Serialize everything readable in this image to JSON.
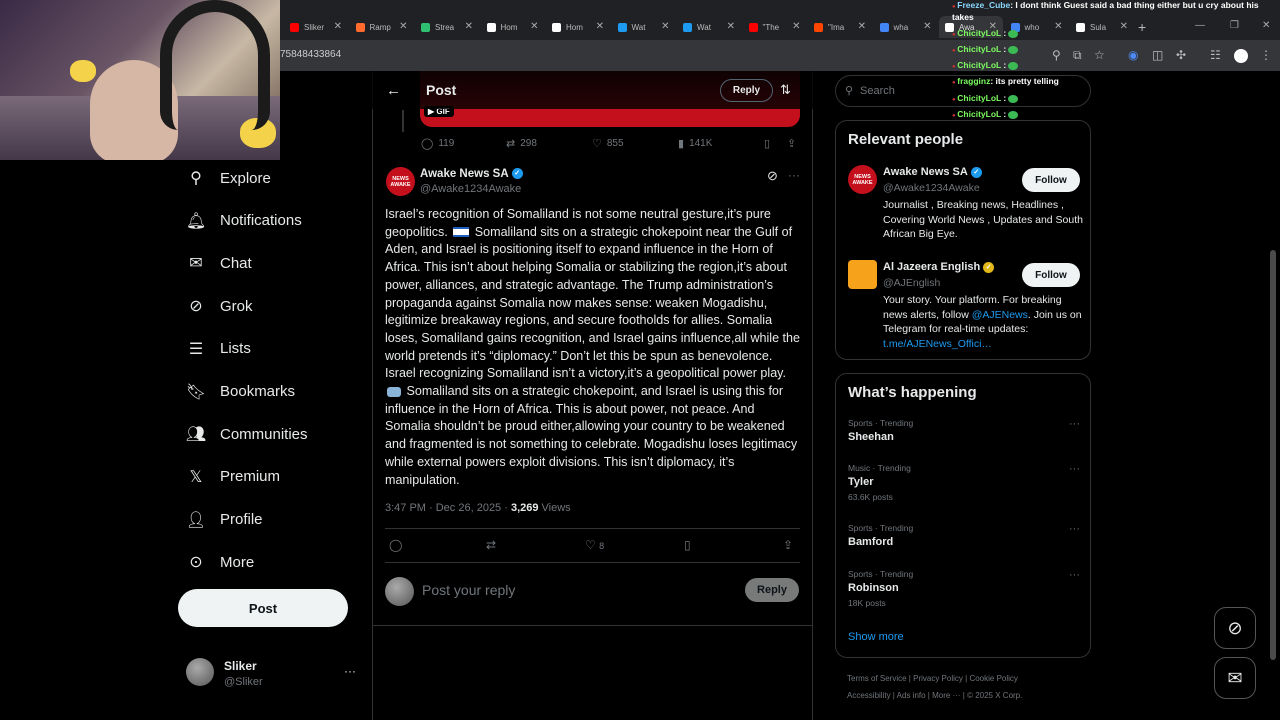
{
  "browser": {
    "tabs": [
      {
        "label": "Sliker",
        "color": "#ff0000"
      },
      {
        "label": "Ramp",
        "color": "#ff6b2c"
      },
      {
        "label": "Strea",
        "color": "#2fbf71"
      },
      {
        "label": "Hom",
        "color": "#ffffff"
      },
      {
        "label": "Hom",
        "color": "#ffffff"
      },
      {
        "label": "Wat",
        "color": "#1d9bf0"
      },
      {
        "label": "Wat",
        "color": "#1d9bf0"
      },
      {
        "label": "\"The",
        "color": "#ff0000"
      },
      {
        "label": "\"Ima",
        "color": "#ff4500"
      },
      {
        "label": "wha",
        "color": "#4285f4"
      },
      {
        "label": "Awa",
        "color": "#ffffff"
      },
      {
        "label": "who",
        "color": "#4285f4"
      },
      {
        "label": "Sula",
        "color": "#ffffff"
      }
    ],
    "url": "75848433864"
  },
  "chat": [
    {
      "user": "Freeze_Cube",
      "color": "blue",
      "msg": ": I dont think Guest said a bad thing either but u cry about his"
    },
    {
      "user": "",
      "color": "blue",
      "msg": "takes"
    },
    {
      "user": "ChicityLoL",
      "color": "green",
      "msg": " :"
    },
    {
      "user": "ChicityLoL",
      "color": "green",
      "msg": " :"
    },
    {
      "user": "ChicityLoL",
      "color": "green",
      "msg": " :"
    },
    {
      "user": "fragginz",
      "color": "green",
      "msg": ": its pretty telling"
    },
    {
      "user": "ChicityLoL",
      "color": "green",
      "msg": " :"
    },
    {
      "user": "ChicityLoL",
      "color": "green",
      "msg": " :"
    }
  ],
  "sidebar": {
    "items": [
      {
        "label": "Explore",
        "icon": "search-icon",
        "glyph": "⚲"
      },
      {
        "label": "Notifications",
        "icon": "bell-icon",
        "glyph": "🔔︎"
      },
      {
        "label": "Chat",
        "icon": "mail-icon",
        "glyph": "✉"
      },
      {
        "label": "Grok",
        "icon": "grok-icon",
        "glyph": "⊘"
      },
      {
        "label": "Lists",
        "icon": "list-icon",
        "glyph": "☰"
      },
      {
        "label": "Bookmarks",
        "icon": "bookmark-icon",
        "glyph": "🔖︎"
      },
      {
        "label": "Communities",
        "icon": "people-icon",
        "glyph": "👥︎"
      },
      {
        "label": "Premium",
        "icon": "x-logo-icon",
        "glyph": "𝕏"
      },
      {
        "label": "Profile",
        "icon": "person-icon",
        "glyph": "👤︎"
      },
      {
        "label": "More",
        "icon": "more-circle-icon",
        "glyph": "⊙"
      }
    ],
    "post_label": "Post",
    "account_name": "Sliker",
    "account_handle": "@Sliker"
  },
  "main": {
    "title": "Post",
    "reply_label": "Reply",
    "media_badge": "GIF",
    "prev_stats": {
      "replies": "119",
      "reposts": "298",
      "likes": "855",
      "views": "141K"
    },
    "tweet": {
      "author": "Awake News SA",
      "handle": "@Awake1234Awake",
      "avatar_text": "NEWS AWAKE",
      "p1": "Israel’s recognition of Somaliland is not some neutral gesture,it’s pure geopolitics.",
      "p2": " Somaliland sits on a strategic chokepoint near the Gulf of Aden, and Israel is positioning itself to expand influence in the Horn of Africa. This isn’t about helping Somalia or stabilizing the region,it’s about power, alliances, and strategic advantage.  The Trump administration’s propaganda against Somalia now makes sense: weaken Mogadishu, legitimize breakaway regions, and secure footholds for allies.  Somalia loses, Somaliland gains recognition, and Israel gains influence,all while the world pretends it’s “diplomacy.” Don’t let this be spun as benevolence. Israel recognizing Somaliland isn’t a victory,it’s a geopolitical power play.",
      "p3": " Somaliland sits on a strategic chokepoint, and Israel is using this for influence in the Horn of Africa. This is about power, not peace.  And Somalia shouldn’t be proud either,allowing your country to be weakened and fragmented is not something to celebrate. Mogadishu loses legitimacy while external powers exploit divisions. This isn’t diplomacy, it’s manipulation.",
      "time": "3:47 PM · Dec 26, 2025 · ",
      "views": "3,269",
      "views_label": " Views",
      "likes": "8"
    },
    "reply_placeholder": "Post your reply",
    "reply_button": "Reply"
  },
  "right": {
    "search_placeholder": "Search",
    "relevant_title": "Relevant people",
    "people": [
      {
        "name": "Awake News SA",
        "handle": "@Awake1234Awake",
        "bio": "Journalist , Breaking news, Headlines , Covering World News , Updates and South African Big Eye.",
        "follow": "Follow"
      },
      {
        "name": "Al Jazeera English",
        "handle": "@AJEnglish",
        "bio1": "Your story. Your platform. For breaking news alerts, follow ",
        "bio_link": "@AJENews",
        "bio2": ". Join us on Telegram for real-time updates: ",
        "bio_url": "t.me/AJENews_Offici…",
        "follow": "Follow"
      }
    ],
    "happening_title": "What’s happening",
    "trends": [
      {
        "context": "Sports · Trending",
        "name": "Sheehan",
        "count": ""
      },
      {
        "context": "Music · Trending",
        "name": "Tyler",
        "count": "63.6K posts"
      },
      {
        "context": "Sports · Trending",
        "name": "Bamford",
        "count": ""
      },
      {
        "context": "Sports · Trending",
        "name": "Robinson",
        "count": "18K posts"
      }
    ],
    "show_more": "Show more",
    "footer1": [
      "Terms of Service",
      "Privacy Policy",
      "Cookie Policy"
    ],
    "footer2": [
      "Accessibility",
      "Ads info",
      "More ···",
      "© 2025 X Corp."
    ]
  }
}
